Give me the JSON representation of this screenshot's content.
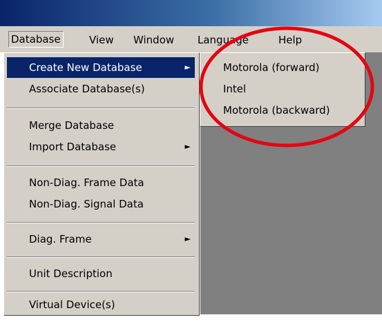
{
  "menubar": {
    "items": [
      {
        "label": "Database"
      },
      {
        "label": "View"
      },
      {
        "label": "Window"
      },
      {
        "label": "Language"
      },
      {
        "label": "Help"
      }
    ]
  },
  "database_menu": {
    "items": [
      {
        "label": "Create New Database",
        "has_submenu": true,
        "highlighted": true
      },
      {
        "label": "Associate Database(s)"
      },
      {
        "label": "Merge Database"
      },
      {
        "label": "Import Database",
        "has_submenu": true
      },
      {
        "label": "Non-Diag. Frame Data"
      },
      {
        "label": "Non-Diag. Signal Data"
      },
      {
        "label": "Diag. Frame",
        "has_submenu": true
      },
      {
        "label": "Unit Description"
      },
      {
        "label": "Virtual Device(s)"
      }
    ],
    "submenu_arrow": "►"
  },
  "create_submenu": {
    "items": [
      {
        "label": "Motorola (forward)"
      },
      {
        "label": "Intel"
      },
      {
        "label": "Motorola (backward)"
      }
    ]
  },
  "colors": {
    "menu_bg": "#d4d0c8",
    "highlight": "#0a246a",
    "workspace": "#808080",
    "annotation": "#e30613"
  },
  "icons": {
    "submenu_arrow": "chevron-right-icon"
  }
}
